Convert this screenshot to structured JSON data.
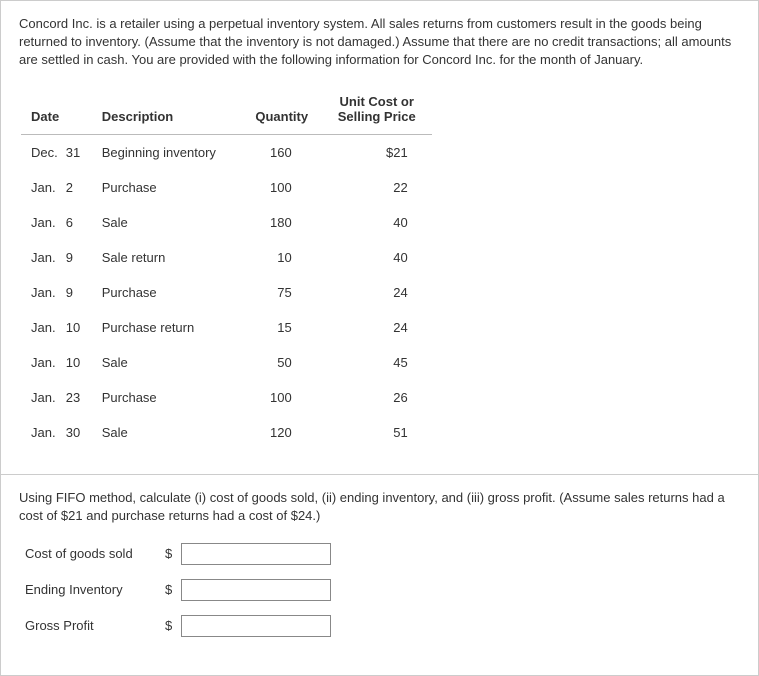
{
  "intro": "Concord Inc. is a retailer using a perpetual inventory system. All sales returns from customers result in the goods being returned to inventory. (Assume that the inventory is not damaged.) Assume that there are no credit transactions; all amounts are settled in cash. You are provided with the following information for Concord Inc. for the month of January.",
  "headers": {
    "date": "Date",
    "description": "Description",
    "quantity": "Quantity",
    "price_l1": "Unit Cost or",
    "price_l2": "Selling Price"
  },
  "rows": [
    {
      "month": "Dec.",
      "day": "31",
      "desc": "Beginning inventory",
      "qty": "160",
      "price": "$21"
    },
    {
      "month": "Jan.",
      "day": "2",
      "desc": "Purchase",
      "qty": "100",
      "price": "22"
    },
    {
      "month": "Jan.",
      "day": "6",
      "desc": "Sale",
      "qty": "180",
      "price": "40"
    },
    {
      "month": "Jan.",
      "day": "9",
      "desc": "Sale return",
      "qty": "10",
      "price": "40"
    },
    {
      "month": "Jan.",
      "day": "9",
      "desc": "Purchase",
      "qty": "75",
      "price": "24"
    },
    {
      "month": "Jan.",
      "day": "10",
      "desc": "Purchase return",
      "qty": "15",
      "price": "24"
    },
    {
      "month": "Jan.",
      "day": "10",
      "desc": "Sale",
      "qty": "50",
      "price": "45"
    },
    {
      "month": "Jan.",
      "day": "23",
      "desc": "Purchase",
      "qty": "100",
      "price": "26"
    },
    {
      "month": "Jan.",
      "day": "30",
      "desc": "Sale",
      "qty": "120",
      "price": "51"
    }
  ],
  "instr": "Using FIFO method, calculate (i) cost of goods sold, (ii) ending inventory, and (iii) gross profit. (Assume sales returns had a cost of $21 and purchase returns had a cost of $24.)",
  "labels": {
    "cogs": "Cost of goods sold",
    "ending": "Ending Inventory",
    "gross": "Gross Profit",
    "currency": "$"
  },
  "values": {
    "cogs": "",
    "ending": "",
    "gross": ""
  }
}
